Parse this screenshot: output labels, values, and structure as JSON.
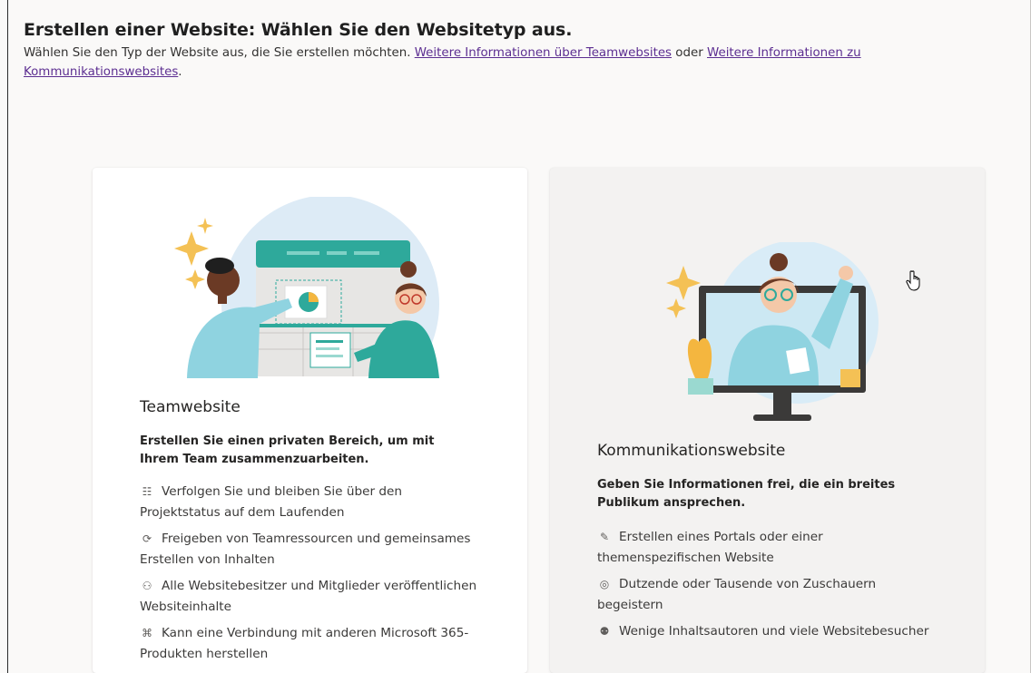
{
  "header": {
    "title": "Erstellen einer Website: Wählen Sie den Websitetyp aus.",
    "intro": "Wählen Sie den Typ der Website aus, die Sie erstellen möchten. ",
    "link_team": "Weitere Informationen über Teamwebsites",
    "connector": " oder ",
    "link_comm": "Weitere Informationen zu Kommunikationswebsites",
    "end": "."
  },
  "cards": {
    "team": {
      "title": "Teamwebsite",
      "description": "Erstellen Sie einen privaten Bereich, um mit Ihrem Team zusammenzuarbeiten.",
      "features": [
        {
          "icon": "checklist-icon",
          "glyph": "☷",
          "text": "Verfolgen Sie und bleiben Sie über den Projektstatus auf dem Laufenden"
        },
        {
          "icon": "sync-icon",
          "glyph": "⟳",
          "text": "Freigeben von Teamressourcen und gemeinsames Erstellen von Inhalten"
        },
        {
          "icon": "people-icon",
          "glyph": "⚇",
          "text": "Alle Websitebesitzer und Mitglieder veröffentlichen Websiteinhalte"
        },
        {
          "icon": "connect-icon",
          "glyph": "⌘",
          "text": "Kann eine Verbindung mit anderen Microsoft 365-Produkten herstellen"
        }
      ]
    },
    "communication": {
      "title": "Kommunikationswebsite",
      "description": "Geben Sie Informationen frei, die ein breites Publikum ansprechen.",
      "features": [
        {
          "icon": "compose-icon",
          "glyph": "✎",
          "text": "Erstellen eines Portals oder einer themenspezifischen Website"
        },
        {
          "icon": "broadcast-icon",
          "glyph": "◎",
          "text": "Dutzende oder Tausende von Zuschauern begeistern"
        },
        {
          "icon": "audience-icon",
          "glyph": "⚉",
          "text": "Wenige Inhaltsautoren und viele Websitebesucher"
        }
      ]
    }
  },
  "colors": {
    "link": "#5c2e91",
    "teal": "#2ea99b",
    "card_selected_bg": "#f3f2f1"
  }
}
